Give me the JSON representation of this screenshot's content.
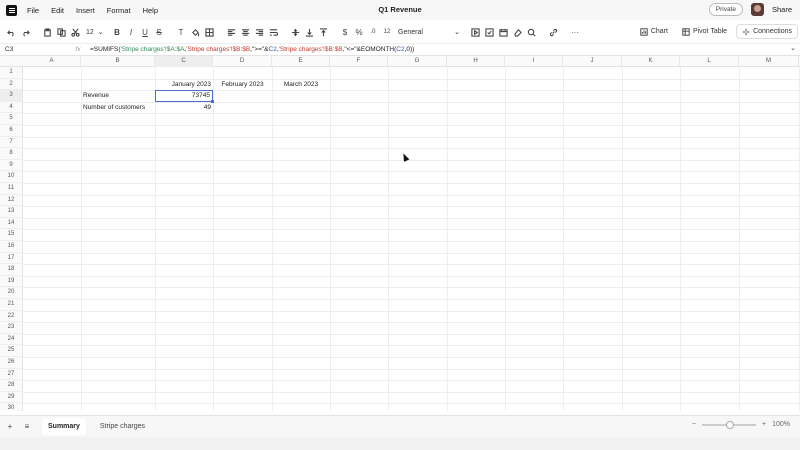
{
  "menubar": {
    "items": [
      "File",
      "Edit",
      "Insert",
      "Format",
      "Help"
    ],
    "title": "Q1 Revenue",
    "private_label": "Private",
    "share_label": "Share"
  },
  "toolbar": {
    "font_size": "12",
    "number_format": "General",
    "chart_label": "Chart",
    "pivot_label": "Pivot Table",
    "connections_label": "Connections"
  },
  "formula_bar": {
    "cell_ref": "C3",
    "fx": "fx",
    "formula_parts": [
      "=SUMIFS(",
      "'Stripe charges'!$A:$A",
      ",",
      "'Stripe charges'!$B:$B",
      ",\">=\"&",
      "C2",
      ",",
      "'Stripe charges'!$B:$B",
      ",\"<=\"&EOMONTH(",
      "C2",
      ",0))"
    ]
  },
  "grid": {
    "columns": [
      "A",
      "B",
      "C",
      "D",
      "E",
      "F",
      "G",
      "H",
      "I",
      "J",
      "K",
      "L",
      "M"
    ],
    "rows": [
      "1",
      "2",
      "3",
      "4",
      "5",
      "6",
      "7",
      "8",
      "9",
      "10",
      "11",
      "12",
      "13",
      "14",
      "15",
      "16",
      "17",
      "18",
      "19",
      "20",
      "21",
      "22",
      "23",
      "24",
      "25",
      "26",
      "27",
      "28",
      "29",
      "30"
    ],
    "cells": {
      "C2": "January 2023",
      "D2": "February 2023",
      "E2": "March 2023",
      "B3": "Revenue",
      "C3": "73745",
      "B4": "Number of customers",
      "C4": "49"
    },
    "selected_cell": "C3"
  },
  "bottombar": {
    "add": "+",
    "menu": "≡",
    "sheets": [
      "Summary",
      "Stripe charges"
    ],
    "active_sheet": "Summary",
    "zoom_minus": "−",
    "zoom_plus": "+",
    "zoom_level": "100%"
  },
  "colors": {
    "selection": "#4a6fd1",
    "formula_green": "#2e8b57",
    "formula_red": "#c0392b",
    "formula_blue": "#2a5db0"
  }
}
